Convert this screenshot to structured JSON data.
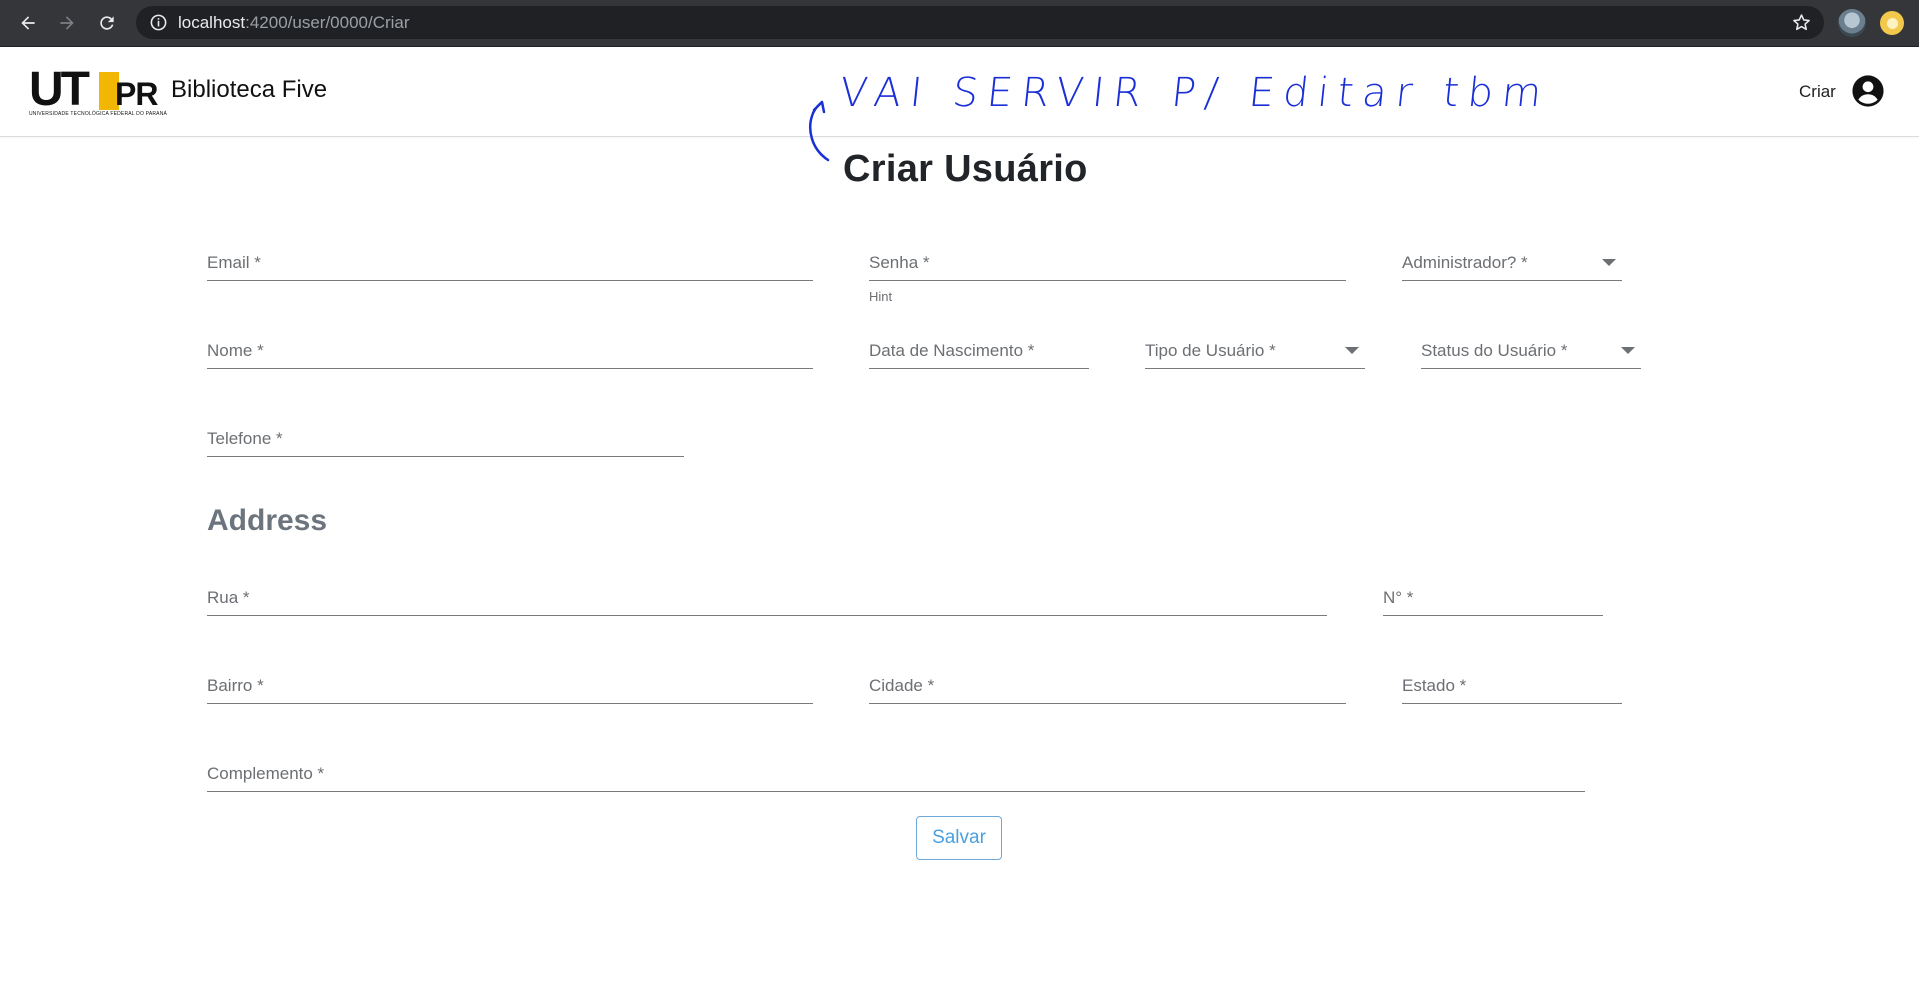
{
  "browser": {
    "url_host": "localhost",
    "url_rest": ":4200/user/0000/Criar",
    "icons": [
      "back-arrow-icon",
      "forward-arrow-icon",
      "reload-icon",
      "info-icon",
      "star-icon",
      "profile-avatar",
      "extension-icon"
    ]
  },
  "header": {
    "logo": {
      "ut": "UT",
      "pr": "PR",
      "tagline": "UNIVERSIDADE TECNOLÓGICA FEDERAL DO PARANÁ"
    },
    "app_title": "Biblioteca Five",
    "action_label": "Criar",
    "account_icon": "account-circle-icon"
  },
  "annotation": {
    "text": "VAI SERVIR P/ Editar tbm",
    "color": "#1a2fd6"
  },
  "page": {
    "title": "Criar Usuário",
    "fields": {
      "email": "Email *",
      "senha": "Senha *",
      "senha_hint": "Hint",
      "administrador": "Administrador? *",
      "nome": "Nome *",
      "data_nascimento": "Data de Nascimento *",
      "tipo_usuario": "Tipo de Usuário *",
      "status_usuario": "Status do Usuário *",
      "telefone": "Telefone *"
    },
    "address": {
      "title": "Address",
      "rua": "Rua *",
      "numero": "N° *",
      "bairro": "Bairro *",
      "cidade": "Cidade *",
      "estado": "Estado *",
      "complemento": "Complemento *"
    },
    "save_label": "Salvar",
    "colors": {
      "accent": "#4a9fe0",
      "label": "#6c6f73",
      "annotation": "#1a2fd6"
    }
  }
}
